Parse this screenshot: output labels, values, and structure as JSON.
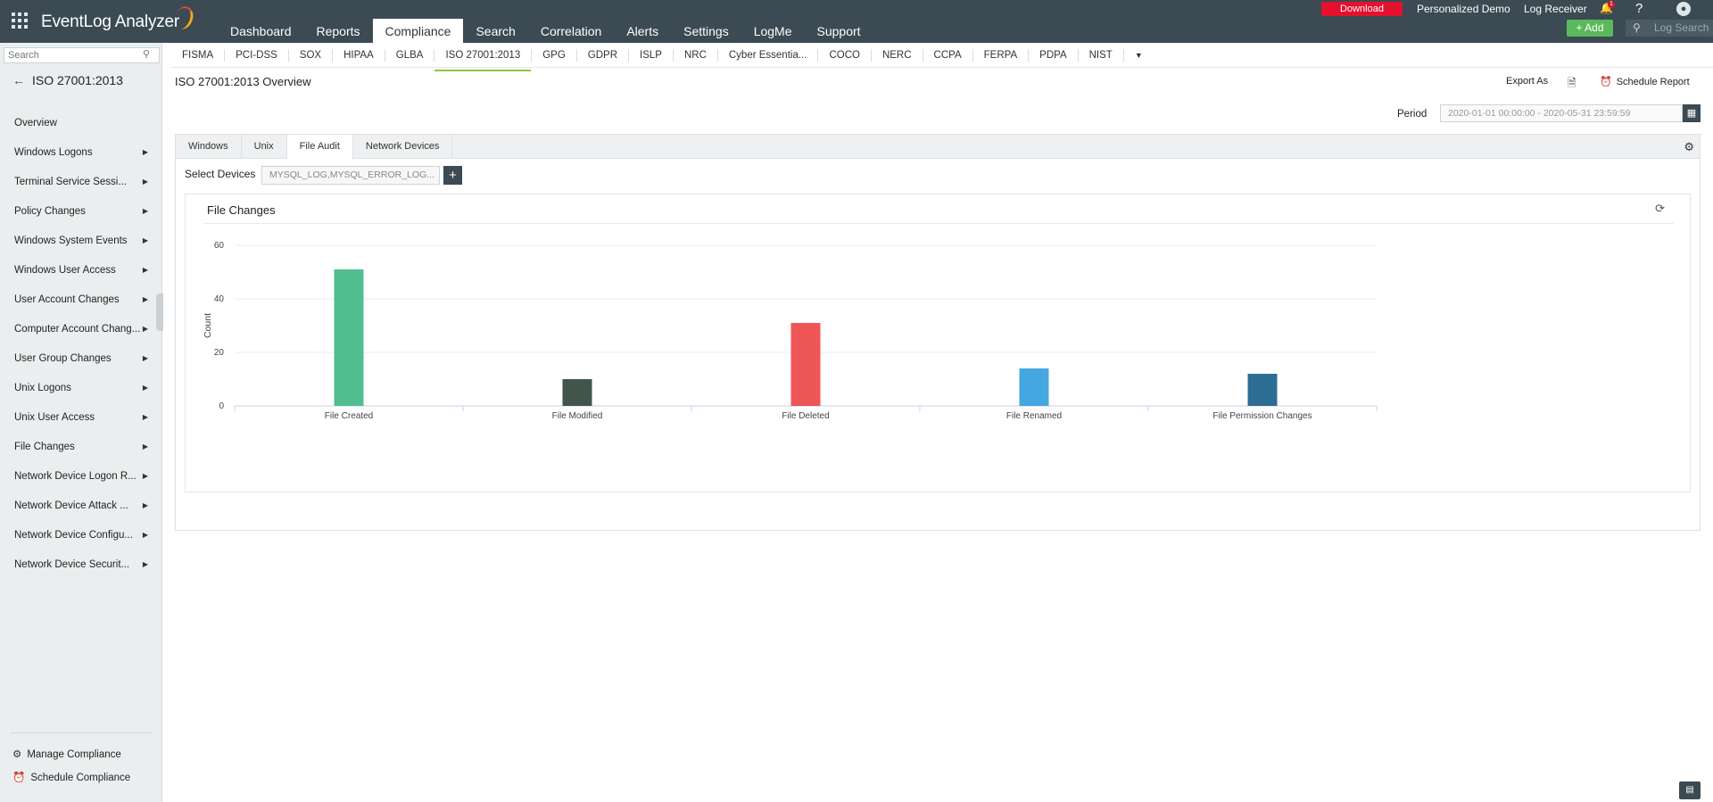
{
  "app": {
    "title": "EventLog Analyzer"
  },
  "nav": [
    "Dashboard",
    "Reports",
    "Compliance",
    "Search",
    "Correlation",
    "Alerts",
    "Settings",
    "LogMe",
    "Support"
  ],
  "topbar": {
    "download": "Download",
    "personalized_demo": "Personalized Demo",
    "log_receiver": "Log Receiver",
    "notification_count": "1",
    "help": "?",
    "add": "+ Add",
    "log_search_placeholder": "Log Search"
  },
  "sidebar": {
    "search_placeholder": "Search",
    "title": "ISO 27001:2013",
    "items": [
      {
        "label": "Overview",
        "has_submenu": false
      },
      {
        "label": "Windows Logons",
        "has_submenu": true
      },
      {
        "label": "Terminal Service Sessi...",
        "has_submenu": true
      },
      {
        "label": "Policy Changes",
        "has_submenu": true
      },
      {
        "label": "Windows System Events",
        "has_submenu": true
      },
      {
        "label": "Windows User Access",
        "has_submenu": true
      },
      {
        "label": "User Account Changes",
        "has_submenu": true
      },
      {
        "label": "Computer Account Chang...",
        "has_submenu": true
      },
      {
        "label": "User Group Changes",
        "has_submenu": true
      },
      {
        "label": "Unix Logons",
        "has_submenu": true
      },
      {
        "label": "Unix User Access",
        "has_submenu": true
      },
      {
        "label": "File Changes",
        "has_submenu": true
      },
      {
        "label": "Network Device Logon R...",
        "has_submenu": true
      },
      {
        "label": "Network Device Attack ...",
        "has_submenu": true
      },
      {
        "label": "Network Device Configu...",
        "has_submenu": true
      },
      {
        "label": "Network Device Securit...",
        "has_submenu": true
      }
    ],
    "manage_compliance": "Manage Compliance",
    "schedule_compliance": "Schedule Compliance"
  },
  "compliance_tabs": [
    "FISMA",
    "PCI-DSS",
    "SOX",
    "HIPAA",
    "GLBA",
    "ISO 27001:2013",
    "GPG",
    "GDPR",
    "ISLP",
    "NRC",
    "Cyber Essentia...",
    "COCO",
    "NERC",
    "CCPA",
    "FERPA",
    "PDPA",
    "NIST"
  ],
  "active_compliance": "ISO 27001:2013",
  "page": {
    "title": "ISO 27001:2013 Overview",
    "export_as": "Export As",
    "schedule_report": "Schedule Report",
    "period_label": "Period",
    "period_value": "2020-01-01 00:00:00 - 2020-05-31 23:59:59"
  },
  "panel": {
    "tabs": [
      "Windows",
      "Unix",
      "File Audit",
      "Network Devices"
    ],
    "active_tab": "File Audit",
    "select_devices_label": "Select Devices",
    "devices_value": "MYSQL_LOG,MYSQL_ERROR_LOG..."
  },
  "chart_data": {
    "type": "bar",
    "title": "File Changes",
    "xlabel": "",
    "ylabel": "Count",
    "ylim": [
      0,
      60
    ],
    "yticks": [
      0,
      20,
      40,
      60
    ],
    "grid": true,
    "categories": [
      "File Created",
      "File Modified",
      "File Deleted",
      "File Renamed",
      "File Permission Changes"
    ],
    "values": [
      51,
      10,
      31,
      14,
      12
    ],
    "colors": [
      "#52bd8e",
      "#42554b",
      "#ef5656",
      "#45a7e0",
      "#2d6c93"
    ]
  },
  "colors": {
    "topbar": "#3b4a53",
    "accent_green": "#8cc63f",
    "download_red": "#e3112e",
    "add_green": "#5cb85c"
  }
}
